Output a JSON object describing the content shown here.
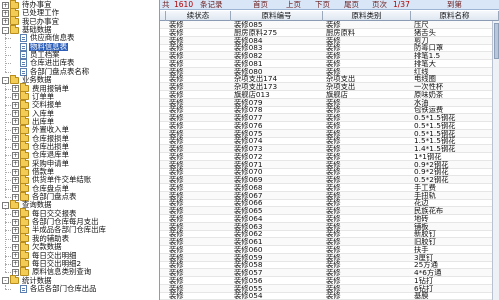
{
  "tree": {
    "nodes": [
      {
        "label": "待办事宜",
        "toggle": "+",
        "icon": "folder-icon",
        "selected": false
      },
      {
        "label": "已处理工作",
        "toggle": "+",
        "icon": "folder-icon",
        "selected": false
      },
      {
        "label": "我已办事宜",
        "toggle": "+",
        "icon": "folder-icon",
        "selected": false
      },
      {
        "label": "基础数据",
        "toggle": "-",
        "icon": "folder-icon",
        "selected": false
      },
      {
        "label": "供应商信息表",
        "toggle": "",
        "icon": "doc-icon",
        "selected": false
      },
      {
        "label": "物料信息表",
        "toggle": "",
        "icon": "doc-icon",
        "selected": true
      },
      {
        "label": "员工档案",
        "toggle": "",
        "icon": "doc-icon",
        "selected": false
      },
      {
        "label": "仓库进出库表",
        "toggle": "",
        "icon": "doc-icon",
        "selected": false
      },
      {
        "label": "各部门盘点表名称",
        "toggle": "",
        "icon": "doc-icon",
        "selected": false
      },
      {
        "label": "业务数据",
        "toggle": "-",
        "icon": "folder-icon",
        "selected": false
      },
      {
        "label": "费用报销单",
        "toggle": "+",
        "icon": "folder-icon",
        "selected": false
      },
      {
        "label": "订单单",
        "toggle": "+",
        "icon": "folder-icon",
        "selected": false
      },
      {
        "label": "交料报单",
        "toggle": "+",
        "icon": "folder-icon",
        "selected": false
      },
      {
        "label": "入库单",
        "toggle": "+",
        "icon": "folder-icon",
        "selected": false
      },
      {
        "label": "出库单",
        "toggle": "+",
        "icon": "folder-icon",
        "selected": false
      },
      {
        "label": "外置收入单",
        "toggle": "+",
        "icon": "folder-icon",
        "selected": false
      },
      {
        "label": "仓库报损单",
        "toggle": "+",
        "icon": "folder-icon",
        "selected": false
      },
      {
        "label": "仓库出损单",
        "toggle": "+",
        "icon": "folder-icon",
        "selected": false
      },
      {
        "label": "仓库退库单",
        "toggle": "+",
        "icon": "folder-icon",
        "selected": false
      },
      {
        "label": "采购申请单",
        "toggle": "+",
        "icon": "folder-icon",
        "selected": false
      },
      {
        "label": "借款单",
        "toggle": "+",
        "icon": "folder-icon",
        "selected": false
      },
      {
        "label": "供货单件交单结账",
        "toggle": "+",
        "icon": "folder-icon",
        "selected": false
      },
      {
        "label": "仓库盘点单",
        "toggle": "+",
        "icon": "folder-icon",
        "selected": false
      },
      {
        "label": "各部门盘点表",
        "toggle": "+",
        "icon": "folder-icon",
        "selected": false
      },
      {
        "label": "查询数据",
        "toggle": "-",
        "icon": "folder-icon",
        "selected": false
      },
      {
        "label": "每日交交报表",
        "toggle": "+",
        "icon": "folder-icon",
        "selected": false
      },
      {
        "label": "各部门仓库每月支出",
        "toggle": "+",
        "icon": "folder-icon",
        "selected": false
      },
      {
        "label": "半成品各部门仓库出库",
        "toggle": "+",
        "icon": "folder-icon",
        "selected": false
      },
      {
        "label": "我的辅助表",
        "toggle": "+",
        "icon": "folder-icon",
        "selected": false
      },
      {
        "label": "欠款数据",
        "toggle": "+",
        "icon": "folder-icon",
        "selected": false
      },
      {
        "label": "每日交出明细",
        "toggle": "+",
        "icon": "folder-icon",
        "selected": false
      },
      {
        "label": "每日交出明细2",
        "toggle": "+",
        "icon": "folder-icon",
        "selected": false
      },
      {
        "label": "原料信息类别查询",
        "toggle": "+",
        "icon": "folder-icon",
        "selected": false
      },
      {
        "label": "统计数据",
        "toggle": "-",
        "icon": "folder-icon",
        "selected": false
      },
      {
        "label": "各店各部门仓库出品",
        "toggle": "",
        "icon": "doc-icon",
        "selected": false
      }
    ]
  },
  "statusbar": {
    "total_label": "共",
    "total_count": "1610",
    "records_label": "条记录",
    "first_page": "首页",
    "prev_page": "上页",
    "next_page": "下页",
    "last_page": "尾页",
    "page_label": "页次",
    "page_value": "1/37",
    "goto_label": "到第"
  },
  "grid": {
    "columns": [
      {
        "label": "",
        "width": 6
      },
      {
        "label": "续状态",
        "width": 65
      },
      {
        "label": "原料编号",
        "width": 92
      },
      {
        "label": "原料类别",
        "width": 88
      },
      {
        "label": "原料名称",
        "width": 88
      }
    ],
    "rows": [
      [
        "",
        "装修",
        "装修085",
        "装修",
        "压尺"
      ],
      [
        "",
        "装修",
        "厨房原料275",
        "厨房原料",
        "猪舌头"
      ],
      [
        "",
        "装修",
        "装修084",
        "装修",
        "剪刀"
      ],
      [
        "",
        "装修",
        "装修083",
        "装修",
        "防毒口罩"
      ],
      [
        "",
        "装修",
        "装修082",
        "装修",
        "排笔1.5"
      ],
      [
        "",
        "装修",
        "装修081",
        "装修",
        "排笔大"
      ],
      [
        "",
        "装修",
        "装修080",
        "装修",
        "红线"
      ],
      [
        "",
        "装修",
        "杂项支出174",
        "杂项支出",
        "电线圈"
      ],
      [
        "",
        "装修",
        "杂项支出173",
        "杂项支出",
        "一次性杯"
      ],
      [
        "",
        "装修",
        "旗舰店013",
        "旗舰店",
        "原味奶茶"
      ],
      [
        "",
        "装修",
        "装修079",
        "装修",
        "水油"
      ],
      [
        "",
        "装修",
        "装修078",
        "装修",
        "包铁运费"
      ],
      [
        "",
        "装修",
        "装修077",
        "装修",
        "0.5*1.5钢花"
      ],
      [
        "",
        "装修",
        "装修076",
        "装修",
        "0.5*1.5钢花"
      ],
      [
        "",
        "装修",
        "装修075",
        "装修",
        "0.5*1.5钢花"
      ],
      [
        "",
        "装修",
        "装修074",
        "装修",
        "1.5*1.5钢花"
      ],
      [
        "",
        "装修",
        "装修073",
        "装修",
        "1.4*1.5钢花"
      ],
      [
        "",
        "装修",
        "装修072",
        "装修",
        "1*1钢花"
      ],
      [
        "",
        "装修",
        "装修071",
        "装修",
        "0.9*2钢花"
      ],
      [
        "",
        "装修",
        "装修070",
        "装修",
        "0.9*2钢花"
      ],
      [
        "",
        "装修",
        "装修069",
        "装修",
        "0.5*2钢花"
      ],
      [
        "",
        "装修",
        "装修068",
        "装修",
        "手工费"
      ],
      [
        "",
        "装修",
        "装修067",
        "装修",
        "手扭轨"
      ],
      [
        "",
        "装修",
        "装修066",
        "装修",
        "花边"
      ],
      [
        "",
        "装修",
        "装修065",
        "装修",
        "民族花布"
      ],
      [
        "",
        "装修",
        "装修064",
        "装修",
        "地砖"
      ],
      [
        "",
        "装修",
        "装修063",
        "装修",
        "铺板"
      ],
      [
        "",
        "装修",
        "装修062",
        "装修",
        "新胶钉"
      ],
      [
        "",
        "装修",
        "装修061",
        "装修",
        "旧胶钉"
      ],
      [
        "",
        "装修",
        "装修060",
        "装修",
        "扶手"
      ],
      [
        "",
        "装修",
        "装修059",
        "装修",
        "3厘钉"
      ],
      [
        "",
        "装修",
        "装修058",
        "装修",
        "25方通"
      ],
      [
        "",
        "装修",
        "装修057",
        "装修",
        "4*6方通"
      ],
      [
        "",
        "装修",
        "装修056",
        "装修",
        "1钻打"
      ],
      [
        "",
        "装修",
        "装修055",
        "装修",
        "6钻打"
      ],
      [
        "",
        "装修",
        "装修054",
        "装修",
        "基膜"
      ]
    ]
  }
}
